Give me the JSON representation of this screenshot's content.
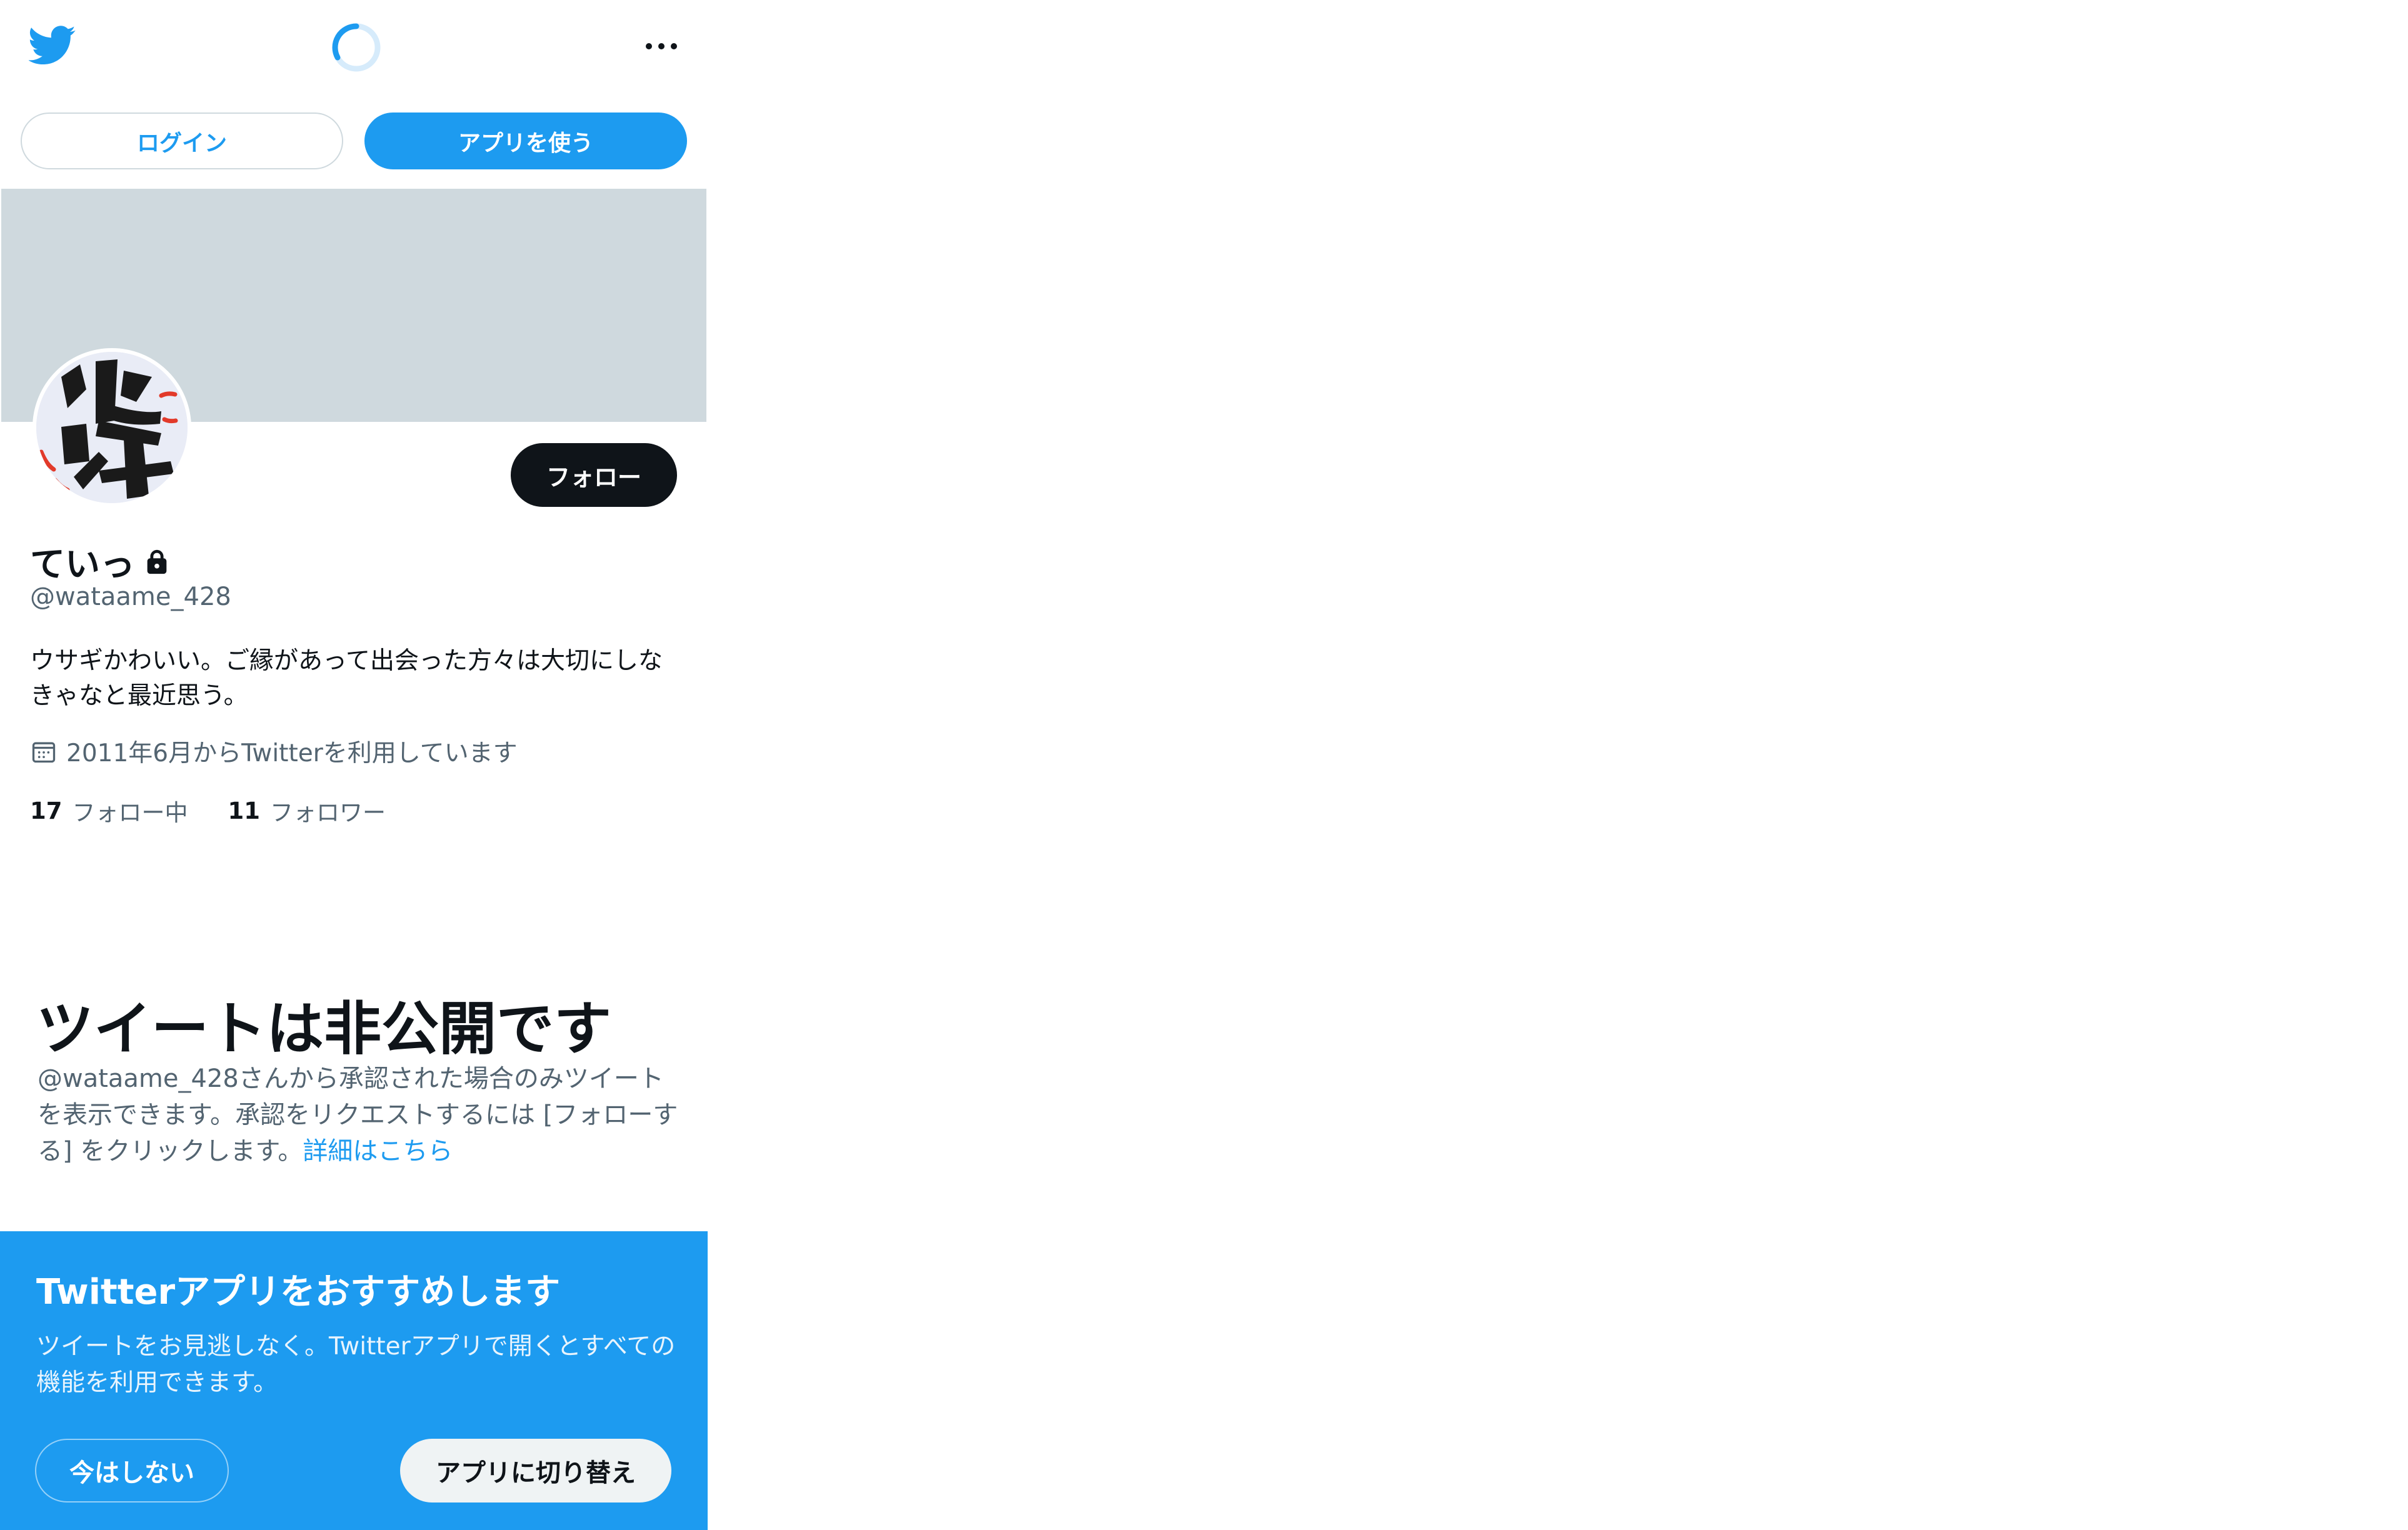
{
  "header": {
    "logo_icon": "twitter-bird-icon",
    "loading_icon": "loading-spinner-icon",
    "more_icon": "more-dots-icon"
  },
  "buttons": {
    "login": "ログイン",
    "use_app": "アプリを使う",
    "follow": "フォロー"
  },
  "profile": {
    "display_name": "ていっ",
    "lock_icon": "lock-icon",
    "handle": "@wataame_428",
    "bio": "ウサギかわいい。ご縁があって出会った方々は大切にしなきゃなと最近思う。",
    "joined": "2011年6月からTwitterを利用しています",
    "following_count": "17",
    "following_label": "フォロー中",
    "followers_count": "11",
    "followers_label": "フォロワー"
  },
  "private_notice": {
    "title": "ツイートは非公開です",
    "description": "@wataame_428さんから承認された場合のみツイートを表示できます。承認をリクエストするには [フォローする] をクリックします。",
    "link": "詳細はこちら"
  },
  "app_promo": {
    "title": "Twitterアプリをおすすめします",
    "description": "ツイートをお見逃しなく。Twitterアプリで開くとすべての機能を利用できます。",
    "not_now": "今はしない",
    "switch": "アプリに切り替え"
  },
  "colors": {
    "brand": "#1d9bf0",
    "banner": "#cfd9de",
    "text": "#0f1419",
    "muted": "#536471"
  }
}
